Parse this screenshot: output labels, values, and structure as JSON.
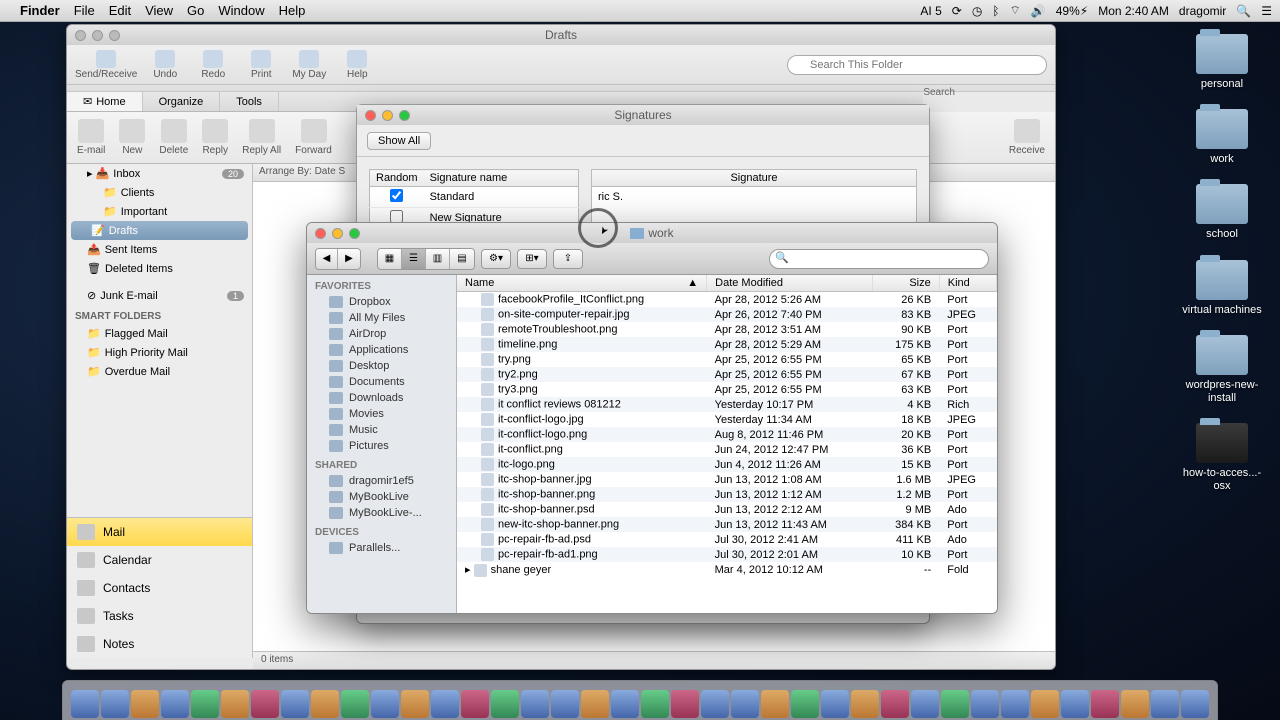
{
  "menubar": {
    "appname": "Finder",
    "items": [
      "File",
      "Edit",
      "View",
      "Go",
      "Window",
      "Help"
    ],
    "right": {
      "adobe": "AI 5",
      "battery": "49%",
      "clock": "Mon 2:40 AM",
      "user": "dragomir"
    }
  },
  "desktop_folders": [
    {
      "label": "personal",
      "type": "folder"
    },
    {
      "label": "work",
      "type": "folder"
    },
    {
      "label": "school",
      "type": "folder"
    },
    {
      "label": "virtual machines",
      "type": "folder"
    },
    {
      "label": "wordpres-new-install",
      "type": "folder"
    },
    {
      "label": "how-to-acces...-osx",
      "type": "image"
    }
  ],
  "outlook": {
    "title": "Drafts",
    "search_placeholder": "Search This Folder",
    "search_label": "Search",
    "toolbar_top": [
      {
        "label": "Send/Receive"
      },
      {
        "label": "Undo"
      },
      {
        "label": "Redo"
      },
      {
        "label": "Print"
      },
      {
        "label": "My Day"
      },
      {
        "label": "Help"
      }
    ],
    "ribbon_tabs": [
      {
        "label": "Home",
        "active": true,
        "icon": "✉"
      },
      {
        "label": "Organize"
      },
      {
        "label": "Tools"
      }
    ],
    "ribbon": [
      {
        "label": "E-mail"
      },
      {
        "label": "New"
      },
      {
        "label": "Delete"
      },
      {
        "label": "Reply"
      },
      {
        "label": "Reply All"
      },
      {
        "label": "Forward"
      }
    ],
    "ribbon_right": [
      {
        "label": "Receive"
      }
    ],
    "nav_tree": {
      "inbox": {
        "label": "Inbox",
        "count": "20",
        "children": [
          "Clients",
          "Important"
        ]
      },
      "drafts": {
        "label": "Drafts",
        "selected": true
      },
      "sent": {
        "label": "Sent Items"
      },
      "deleted": {
        "label": "Deleted Items"
      },
      "junk": {
        "label": "Junk E-mail",
        "count": "1"
      },
      "smart_header": "SMART FOLDERS",
      "smart": [
        "Flagged Mail",
        "High Priority Mail",
        "Overdue Mail"
      ]
    },
    "nav_bottom": [
      {
        "label": "Mail",
        "active": true
      },
      {
        "label": "Calendar"
      },
      {
        "label": "Contacts"
      },
      {
        "label": "Tasks"
      },
      {
        "label": "Notes"
      }
    ],
    "arrange_label": "Arrange By: Date S",
    "status": "0 items"
  },
  "signatures": {
    "title": "Signatures",
    "show_all": "Show All",
    "cols": {
      "random": "Random",
      "name": "Signature name",
      "preview": "Signature"
    },
    "rows": [
      {
        "random": true,
        "name": "Standard"
      },
      {
        "random": false,
        "name": "New Signature"
      }
    ],
    "preview_name": "ric S."
  },
  "finder": {
    "title": "work",
    "sidebar": {
      "favorites_label": "FAVORITES",
      "favorites": [
        "Dropbox",
        "All My Files",
        "AirDrop",
        "Applications",
        "Desktop",
        "Documents",
        "Downloads",
        "Movies",
        "Music",
        "Pictures"
      ],
      "shared_label": "SHARED",
      "shared": [
        "dragomir1ef5",
        "MyBookLive",
        "MyBookLive-..."
      ],
      "devices_label": "DEVICES",
      "devices": [
        "Parallels..."
      ]
    },
    "cols": [
      "Name",
      "Date Modified",
      "Size",
      "Kind"
    ],
    "files": [
      {
        "name": "facebookProfile_ItConflict.png",
        "date": "Apr 28, 2012 5:26 AM",
        "size": "26 KB",
        "kind": "Port"
      },
      {
        "name": "on-site-computer-repair.jpg",
        "date": "Apr 26, 2012 7:40 PM",
        "size": "83 KB",
        "kind": "JPEG"
      },
      {
        "name": "remoteTroubleshoot.png",
        "date": "Apr 28, 2012 3:51 AM",
        "size": "90 KB",
        "kind": "Port"
      },
      {
        "name": "timeline.png",
        "date": "Apr 28, 2012 5:29 AM",
        "size": "175 KB",
        "kind": "Port"
      },
      {
        "name": "try.png",
        "date": "Apr 25, 2012 6:55 PM",
        "size": "65 KB",
        "kind": "Port"
      },
      {
        "name": "try2.png",
        "date": "Apr 25, 2012 6:55 PM",
        "size": "67 KB",
        "kind": "Port"
      },
      {
        "name": "try3.png",
        "date": "Apr 25, 2012 6:55 PM",
        "size": "63 KB",
        "kind": "Port"
      },
      {
        "name": "it conflict reviews 081212",
        "date": "Yesterday 10:17 PM",
        "size": "4 KB",
        "kind": "Rich"
      },
      {
        "name": "it-conflict-logo.jpg",
        "date": "Yesterday 11:34 AM",
        "size": "18 KB",
        "kind": "JPEG"
      },
      {
        "name": "it-conflict-logo.png",
        "date": "Aug 8, 2012 11:46 PM",
        "size": "20 KB",
        "kind": "Port"
      },
      {
        "name": "it-conflict.png",
        "date": "Jun 24, 2012 12:47 PM",
        "size": "36 KB",
        "kind": "Port"
      },
      {
        "name": "itc-logo.png",
        "date": "Jun 4, 2012 11:26 AM",
        "size": "15 KB",
        "kind": "Port"
      },
      {
        "name": "itc-shop-banner.jpg",
        "date": "Jun 13, 2012 1:08 AM",
        "size": "1.6 MB",
        "kind": "JPEG"
      },
      {
        "name": "itc-shop-banner.png",
        "date": "Jun 13, 2012 1:12 AM",
        "size": "1.2 MB",
        "kind": "Port"
      },
      {
        "name": "itc-shop-banner.psd",
        "date": "Jun 13, 2012 2:12 AM",
        "size": "9 MB",
        "kind": "Ado"
      },
      {
        "name": "new-itc-shop-banner.png",
        "date": "Jun 13, 2012 11:43 AM",
        "size": "384 KB",
        "kind": "Port"
      },
      {
        "name": "pc-repair-fb-ad.psd",
        "date": "Jul 30, 2012 2:41 AM",
        "size": "411 KB",
        "kind": "Ado"
      },
      {
        "name": "pc-repair-fb-ad1.png",
        "date": "Jul 30, 2012 2:01 AM",
        "size": "10 KB",
        "kind": "Port"
      },
      {
        "name": "shane geyer",
        "date": "Mar 4, 2012 10:12 AM",
        "size": "--",
        "kind": "Fold",
        "folder": true
      }
    ]
  },
  "dock_count": 38
}
